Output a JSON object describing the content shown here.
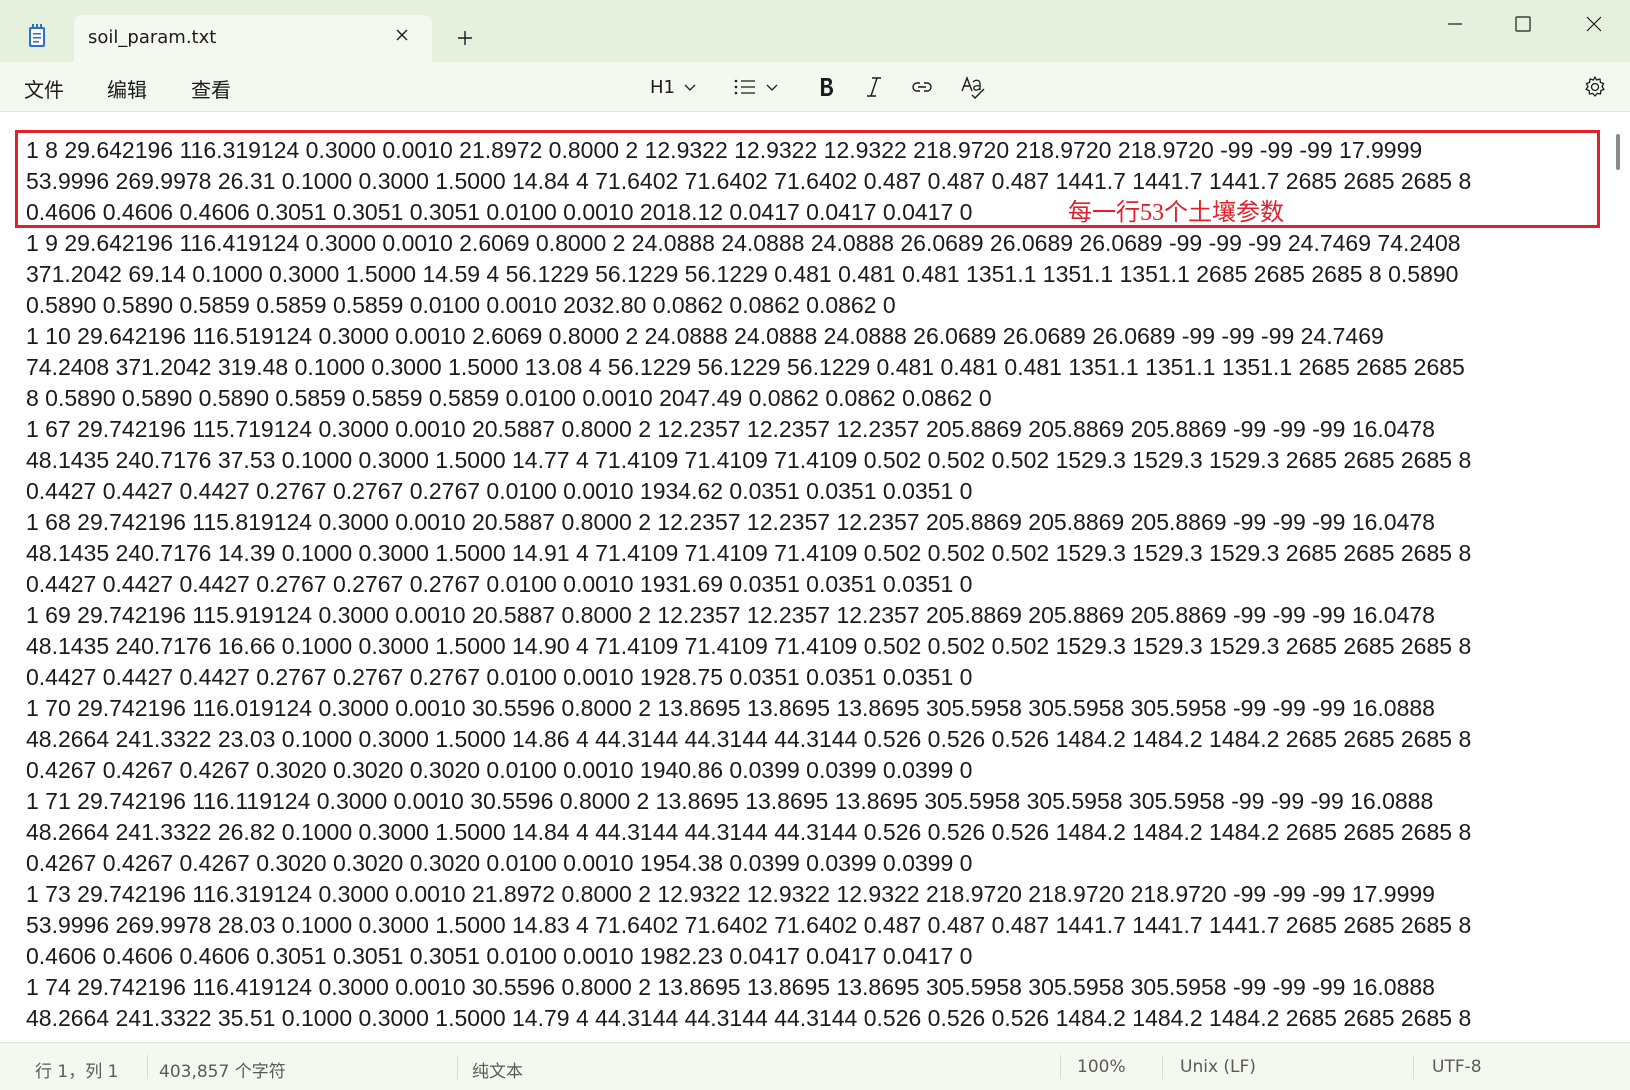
{
  "tab": {
    "title": "soil_param.txt"
  },
  "menu": {
    "file": "文件",
    "edit": "编辑",
    "view": "查看"
  },
  "toolbar": {
    "heading": "H1"
  },
  "annotation": {
    "text": "每一行53个土壤参数"
  },
  "content": {
    "lines": [
      "1 8 29.642196 116.319124 0.3000 0.0010 21.8972 0.8000 2 12.9322 12.9322 12.9322 218.9720 218.9720 218.9720 -99 -99 -99 17.9999",
      "53.9996 269.9978 26.31 0.1000 0.3000 1.5000 14.84 4 71.6402 71.6402 71.6402 0.487 0.487 0.487 1441.7 1441.7 1441.7 2685 2685 2685 8",
      "0.4606 0.4606 0.4606 0.3051 0.3051 0.3051 0.0100 0.0010 2018.12 0.0417 0.0417 0.0417 0",
      "1 9 29.642196 116.419124 0.3000 0.0010 2.6069 0.8000 2 24.0888 24.0888 24.0888 26.0689 26.0689 26.0689 -99 -99 -99 24.7469 74.2408",
      "371.2042 69.14 0.1000 0.3000 1.5000 14.59 4 56.1229 56.1229 56.1229 0.481 0.481 0.481 1351.1 1351.1 1351.1 2685 2685 2685 8 0.5890",
      "0.5890 0.5890 0.5859 0.5859 0.5859 0.0100 0.0010 2032.80 0.0862 0.0862 0.0862 0",
      "1 10 29.642196 116.519124 0.3000 0.0010 2.6069 0.8000 2 24.0888 24.0888 24.0888 26.0689 26.0689 26.0689 -99 -99 -99 24.7469",
      "74.2408 371.2042 319.48 0.1000 0.3000 1.5000 13.08 4 56.1229 56.1229 56.1229 0.481 0.481 0.481 1351.1 1351.1 1351.1 2685 2685 2685",
      "8 0.5890 0.5890 0.5890 0.5859 0.5859 0.5859 0.0100 0.0010 2047.49 0.0862 0.0862 0.0862 0",
      "1 67 29.742196 115.719124 0.3000 0.0010 20.5887 0.8000 2 12.2357 12.2357 12.2357 205.8869 205.8869 205.8869 -99 -99 -99 16.0478",
      "48.1435 240.7176 37.53 0.1000 0.3000 1.5000 14.77 4 71.4109 71.4109 71.4109 0.502 0.502 0.502 1529.3 1529.3 1529.3 2685 2685 2685 8",
      "0.4427 0.4427 0.4427 0.2767 0.2767 0.2767 0.0100 0.0010 1934.62 0.0351 0.0351 0.0351 0",
      "1 68 29.742196 115.819124 0.3000 0.0010 20.5887 0.8000 2 12.2357 12.2357 12.2357 205.8869 205.8869 205.8869 -99 -99 -99 16.0478",
      "48.1435 240.7176 14.39 0.1000 0.3000 1.5000 14.91 4 71.4109 71.4109 71.4109 0.502 0.502 0.502 1529.3 1529.3 1529.3 2685 2685 2685 8",
      "0.4427 0.4427 0.4427 0.2767 0.2767 0.2767 0.0100 0.0010 1931.69 0.0351 0.0351 0.0351 0",
      "1 69 29.742196 115.919124 0.3000 0.0010 20.5887 0.8000 2 12.2357 12.2357 12.2357 205.8869 205.8869 205.8869 -99 -99 -99 16.0478",
      "48.1435 240.7176 16.66 0.1000 0.3000 1.5000 14.90 4 71.4109 71.4109 71.4109 0.502 0.502 0.502 1529.3 1529.3 1529.3 2685 2685 2685 8",
      "0.4427 0.4427 0.4427 0.2767 0.2767 0.2767 0.0100 0.0010 1928.75 0.0351 0.0351 0.0351 0",
      "1 70 29.742196 116.019124 0.3000 0.0010 30.5596 0.8000 2 13.8695 13.8695 13.8695 305.5958 305.5958 305.5958 -99 -99 -99 16.0888",
      "48.2664 241.3322 23.03 0.1000 0.3000 1.5000 14.86 4 44.3144 44.3144 44.3144 0.526 0.526 0.526 1484.2 1484.2 1484.2 2685 2685 2685 8",
      "0.4267 0.4267 0.4267 0.3020 0.3020 0.3020 0.0100 0.0010 1940.86 0.0399 0.0399 0.0399 0",
      "1 71 29.742196 116.119124 0.3000 0.0010 30.5596 0.8000 2 13.8695 13.8695 13.8695 305.5958 305.5958 305.5958 -99 -99 -99 16.0888",
      "48.2664 241.3322 26.82 0.1000 0.3000 1.5000 14.84 4 44.3144 44.3144 44.3144 0.526 0.526 0.526 1484.2 1484.2 1484.2 2685 2685 2685 8",
      "0.4267 0.4267 0.4267 0.3020 0.3020 0.3020 0.0100 0.0010 1954.38 0.0399 0.0399 0.0399 0",
      "1 73 29.742196 116.319124 0.3000 0.0010 21.8972 0.8000 2 12.9322 12.9322 12.9322 218.9720 218.9720 218.9720 -99 -99 -99 17.9999",
      "53.9996 269.9978 28.03 0.1000 0.3000 1.5000 14.83 4 71.6402 71.6402 71.6402 0.487 0.487 0.487 1441.7 1441.7 1441.7 2685 2685 2685 8",
      "0.4606 0.4606 0.4606 0.3051 0.3051 0.3051 0.0100 0.0010 1982.23 0.0417 0.0417 0.0417 0",
      "1 74 29.742196 116.419124 0.3000 0.0010 30.5596 0.8000 2 13.8695 13.8695 13.8695 305.5958 305.5958 305.5958 -99 -99 -99 16.0888",
      "48.2664 241.3322 35.51 0.1000 0.3000 1.5000 14.79 4 44.3144 44.3144 44.3144 0.526 0.526 0.526 1484.2 1484.2 1484.2 2685 2685 2685 8"
    ]
  },
  "status": {
    "position": "行 1，列 1",
    "char_count": "403,857 个字符",
    "format": "纯文本",
    "zoom": "100%",
    "line_ending": "Unix (LF)",
    "encoding": "UTF-8"
  },
  "colors": {
    "annotation": "#e0202a",
    "chrome": "#e6f1dd",
    "toolbar": "#f4f9ef"
  }
}
